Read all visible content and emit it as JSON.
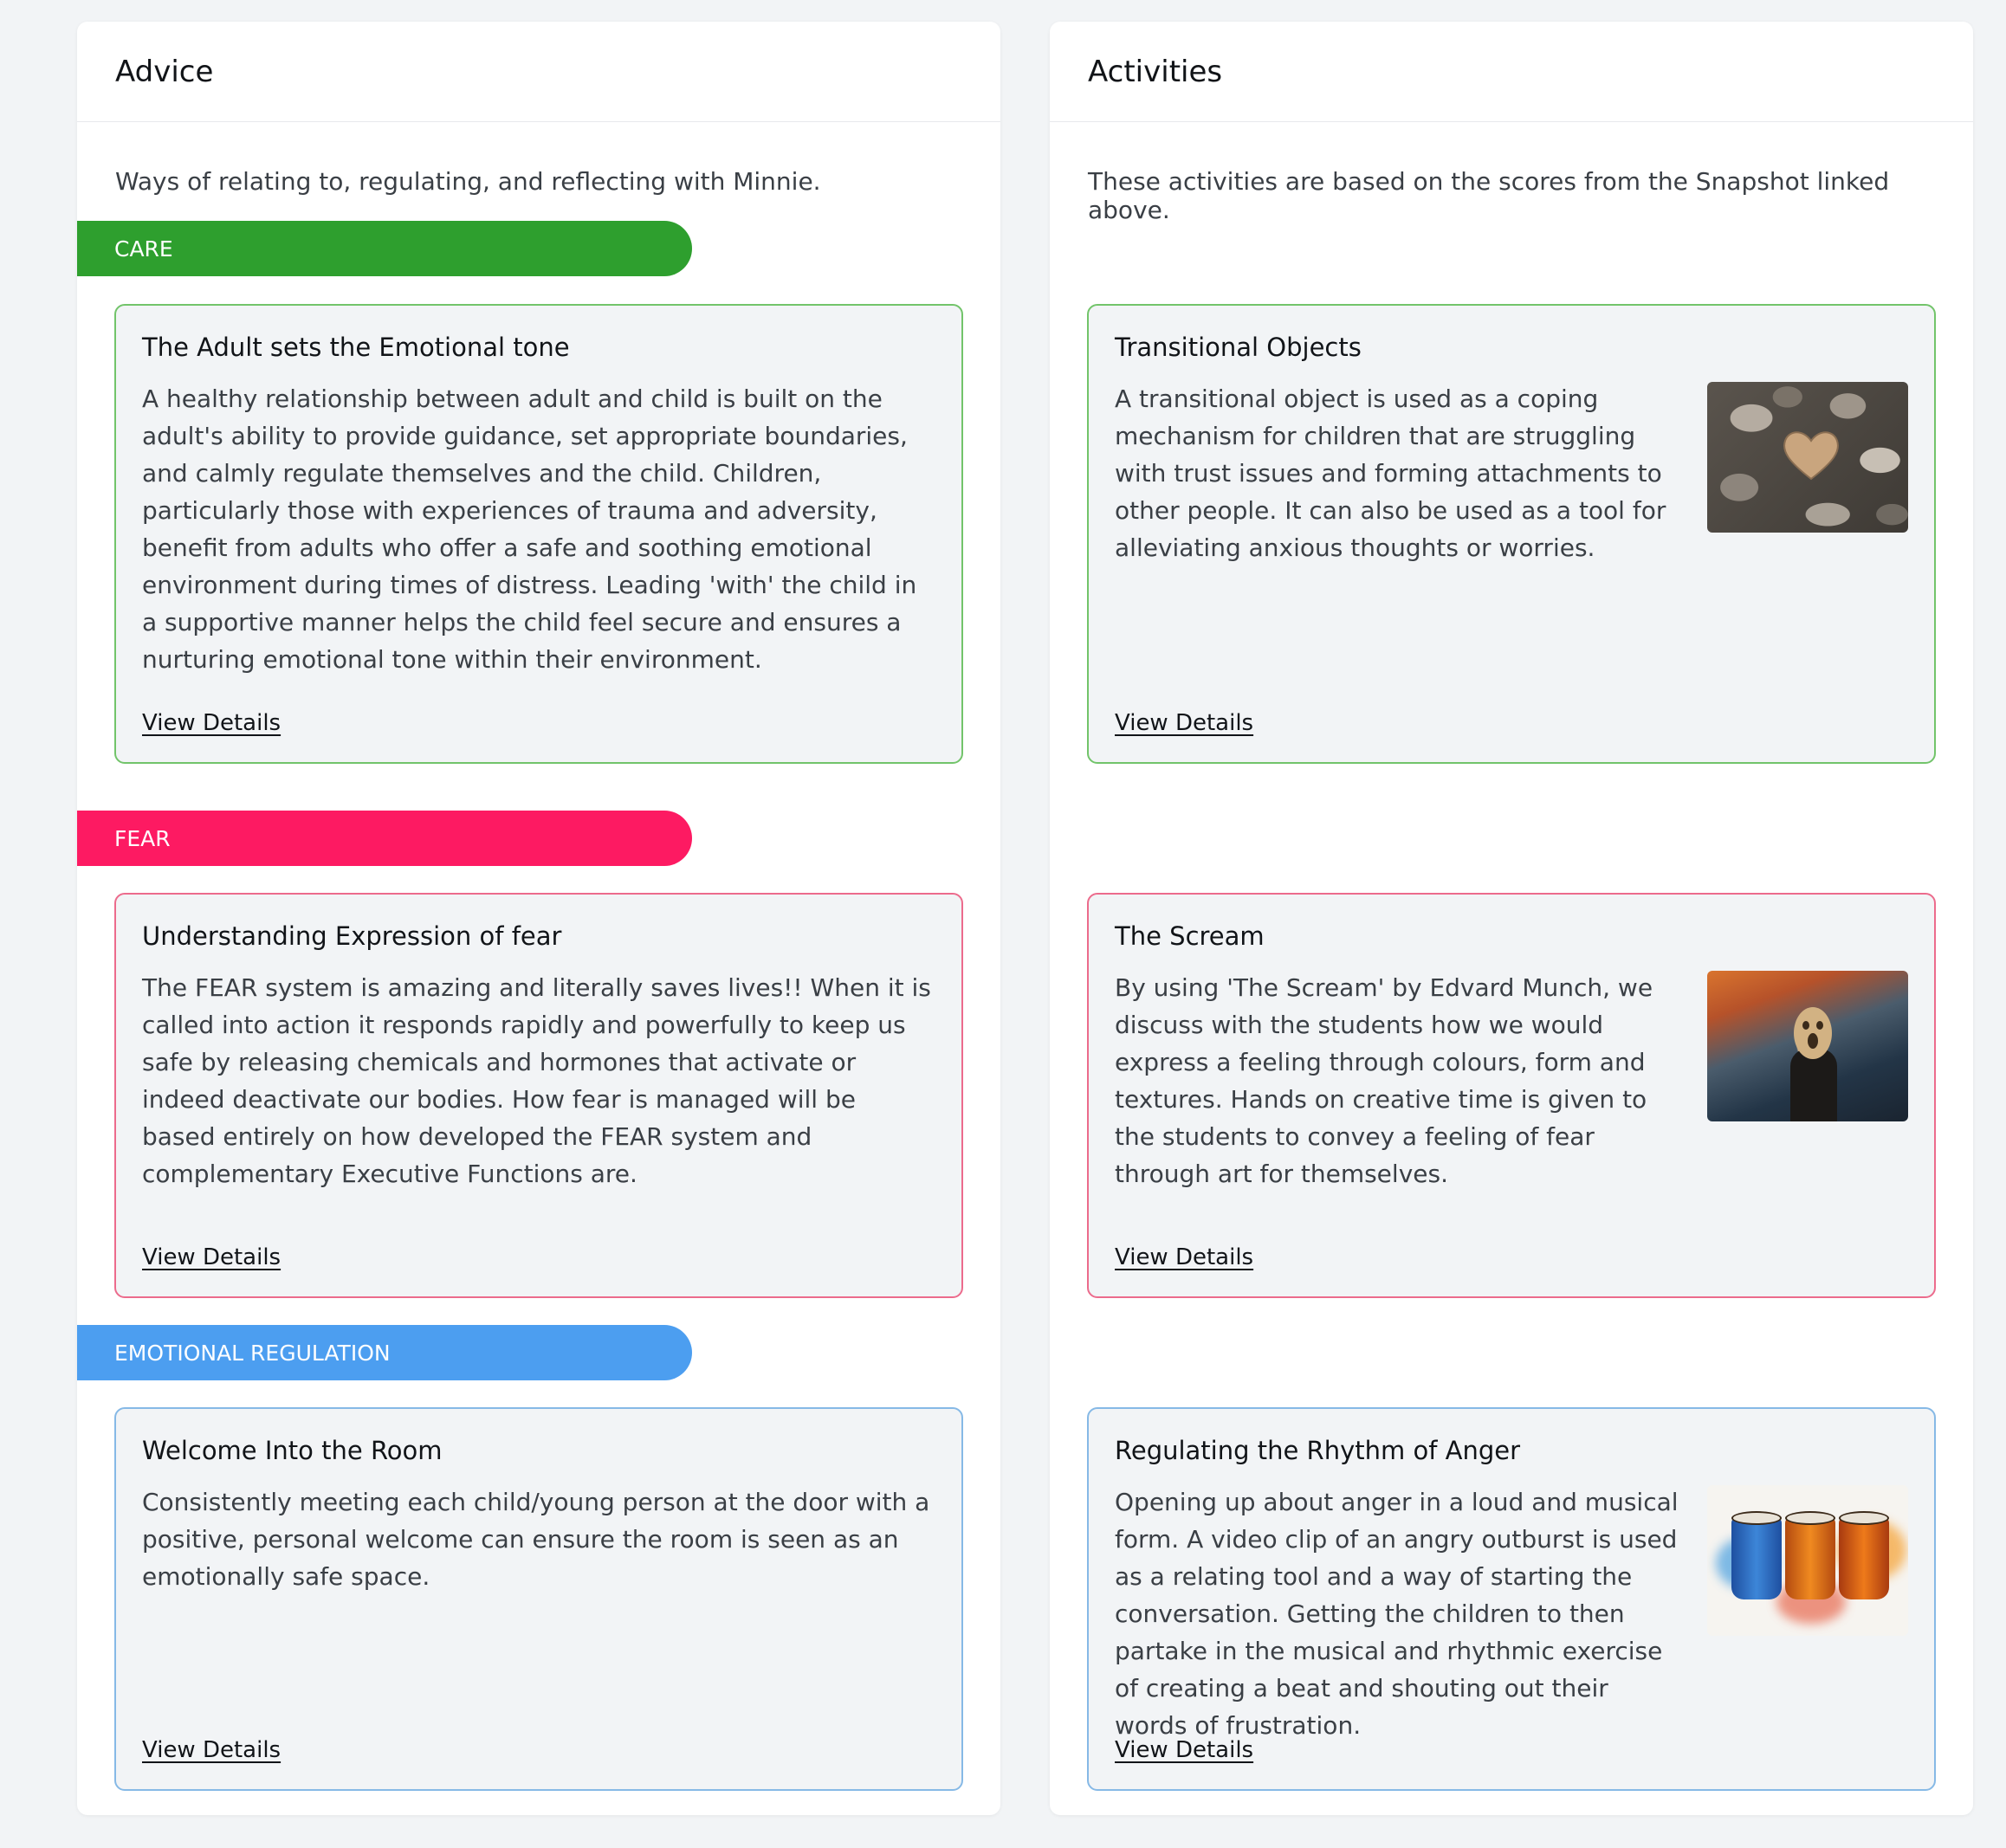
{
  "advice": {
    "title": "Advice",
    "intro": "Ways of relating to, regulating, and reflecting with Minnie.",
    "sections": [
      {
        "label": "CARE",
        "color": "#2e9f2e",
        "card": {
          "title": "The Adult sets the Emotional tone",
          "text": "A healthy relationship between adult and child is built on the adult's ability to provide guidance, set appropriate boundaries, and calmly regulate themselves and the child. Children, particularly those with experiences of trauma and adversity, benefit from adults who offer a safe and soothing emotional environment during times of distress. Leading 'with' the child in a supportive manner helps the child feel secure and ensures a nurturing emotional tone within their environment.",
          "link": "View Details"
        }
      },
      {
        "label": "FEAR",
        "color": "#fd1a62",
        "card": {
          "title": "Understanding Expression of fear",
          "text": "The FEAR system is amazing and literally saves lives!! When it is called into action it responds rapidly and powerfully to keep us safe by releasing chemicals and hormones that activate or indeed deactivate our bodies. How fear is managed will be based entirely on how developed the FEAR system and complementary Executive Functions are.",
          "link": "View Details"
        }
      },
      {
        "label": "EMOTIONAL REGULATION",
        "color": "#4c9ef0",
        "card": {
          "title": "Welcome Into the Room",
          "text": "Consistently meeting each child/young person at the door with a positive, personal welcome can ensure the room is seen as an emotionally safe space.",
          "link": "View Details"
        }
      }
    ]
  },
  "activities": {
    "title": "Activities",
    "intro": "These activities are based on the scores from the Snapshot linked above.",
    "cards": [
      {
        "title": "Transitional Objects",
        "text": "A transitional object is used as a coping mechanism for children that are struggling with trust issues and forming attachments to other people. It can also be used as a tool for alleviating anxious thoughts or worries.",
        "image": "heart-stone-image",
        "link": "View Details"
      },
      {
        "title": "The Scream",
        "text": "By using 'The Scream' by Edvard Munch, we discuss with the students how we would express a feeling through colours, form and textures. Hands on creative time is given to the students to convey a feeling of fear through art for themselves.",
        "image": "scream-painting-image",
        "link": "View Details"
      },
      {
        "title": "Regulating the Rhythm of Anger",
        "text": "Opening up about anger in a loud and musical form. A video clip of an angry outburst is used as a relating tool and a way of starting the conversation. Getting the children to then partake in the musical and rhythmic exercise of creating a beat and shouting out their words of frustration.",
        "image": "drums-image",
        "link": "View Details"
      }
    ]
  }
}
